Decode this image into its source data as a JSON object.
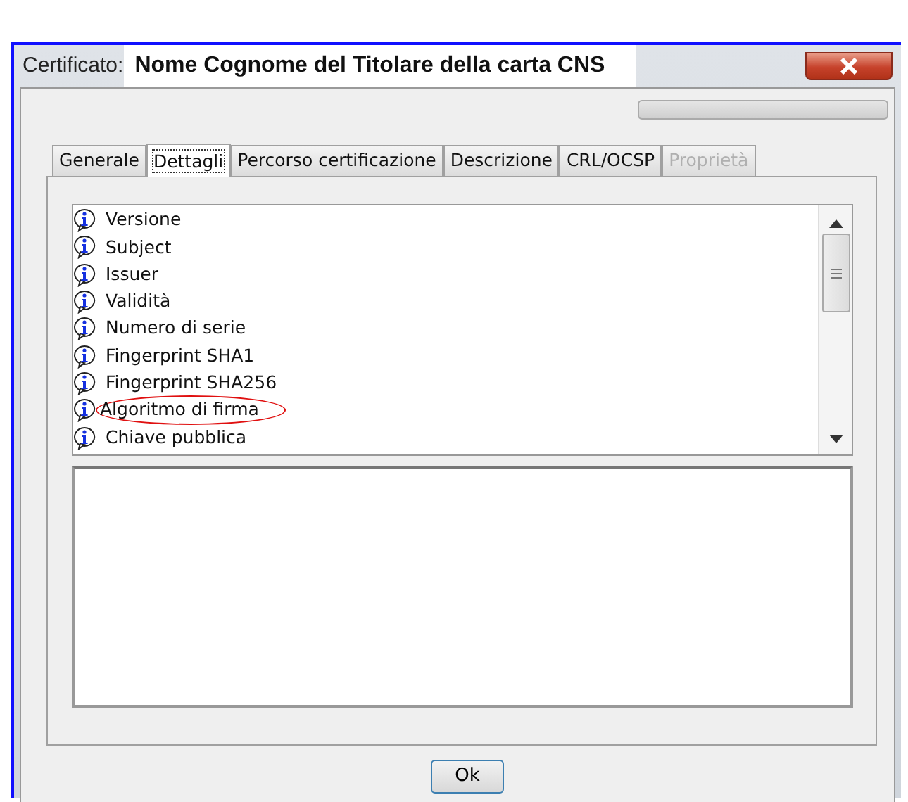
{
  "window": {
    "title_label": "Certificato:",
    "title": "Nome Cognome del Titolare della carta CNS"
  },
  "progress": {
    "level": 0
  },
  "tabs": [
    {
      "label": "Generale",
      "selected": false,
      "disabled": false
    },
    {
      "label": "Dettagli",
      "selected": true,
      "disabled": false
    },
    {
      "label": "Percorso certificazione",
      "selected": false,
      "disabled": false
    },
    {
      "label": "Descrizione",
      "selected": false,
      "disabled": false
    },
    {
      "label": "CRL/OCSP",
      "selected": false,
      "disabled": false
    },
    {
      "label": "Proprietà",
      "selected": false,
      "disabled": true
    }
  ],
  "fields": [
    {
      "label": "Versione",
      "circled": false
    },
    {
      "label": "Subject",
      "circled": false
    },
    {
      "label": "Issuer",
      "circled": false
    },
    {
      "label": "Validità",
      "circled": false
    },
    {
      "label": "Numero di serie",
      "circled": false
    },
    {
      "label": "Fingerprint SHA1",
      "circled": false
    },
    {
      "label": "Fingerprint SHA256",
      "circled": false
    },
    {
      "label": "Algoritmo di firma",
      "circled": true
    },
    {
      "label": "Chiave pubblica",
      "circled": false
    }
  ],
  "buttons": [
    "Ok"
  ]
}
